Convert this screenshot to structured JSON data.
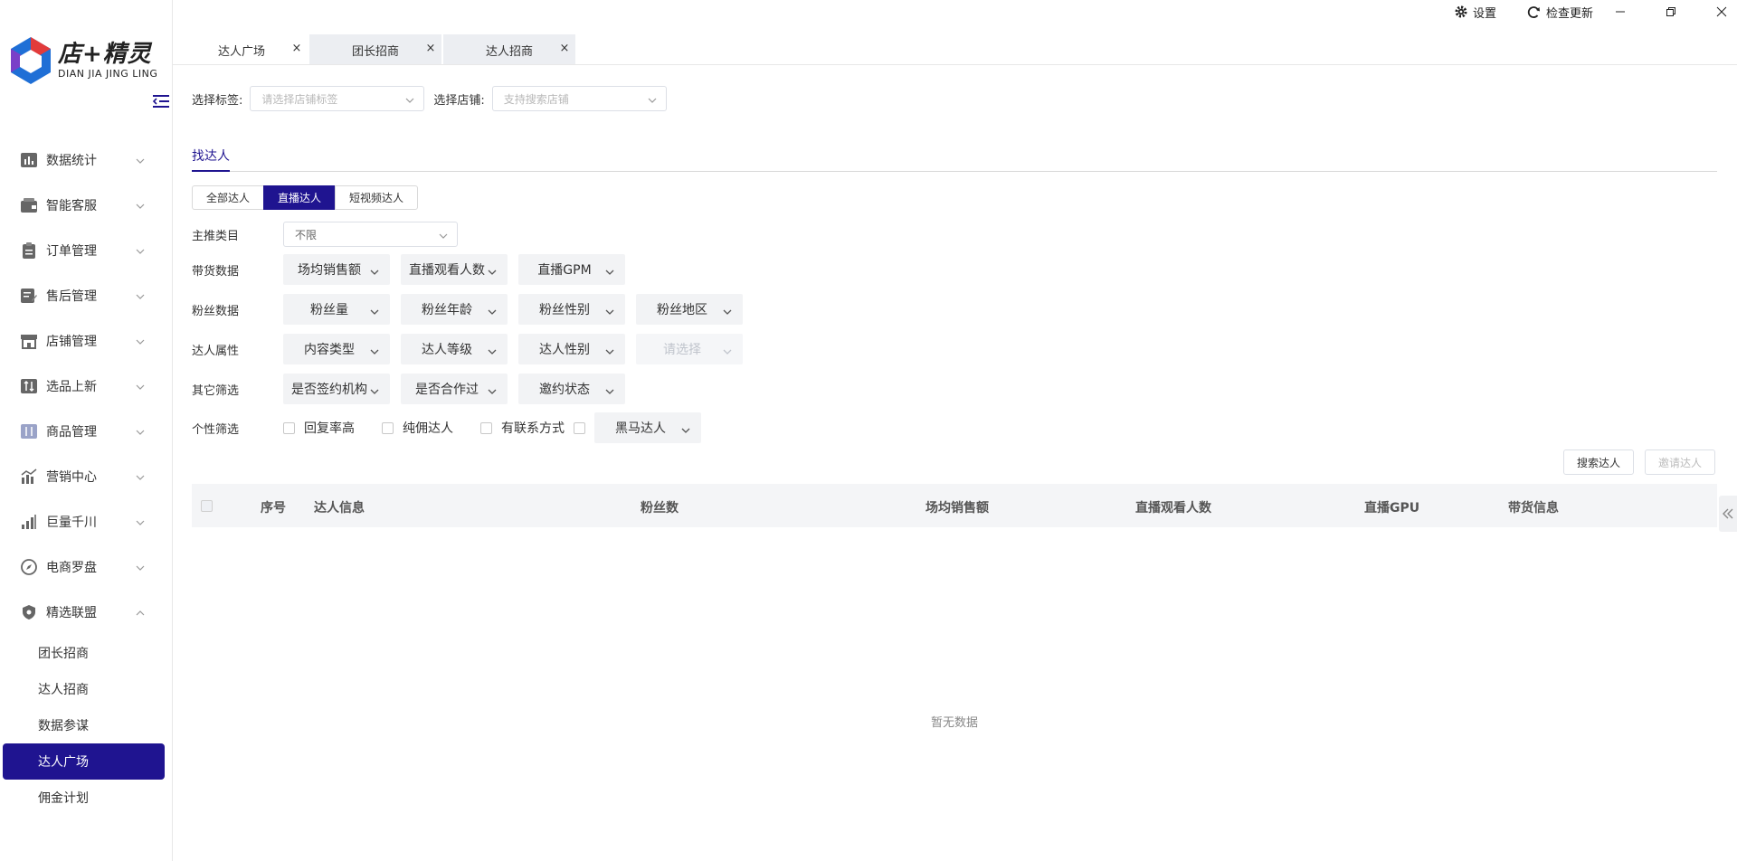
{
  "window": {
    "settings_label": "设置",
    "update_label": "检查更新"
  },
  "brand": {
    "name_cn": "店+精灵",
    "name_en": "DIAN JIA JING LING",
    "colors": {
      "primary": "#1f1490",
      "logo_blue": "#1f6fd6",
      "logo_red": "#e23b3b"
    }
  },
  "sidebar": {
    "items": [
      {
        "label": "数据统计",
        "icon": "bar-chart-icon"
      },
      {
        "label": "智能客服",
        "icon": "wallet-icon"
      },
      {
        "label": "订单管理",
        "icon": "clipboard-icon"
      },
      {
        "label": "售后管理",
        "icon": "edit-note-icon"
      },
      {
        "label": "店铺管理",
        "icon": "store-icon"
      },
      {
        "label": "选品上新",
        "icon": "swap-icon"
      },
      {
        "label": "商品管理",
        "icon": "goods-icon"
      },
      {
        "label": "营销中心",
        "icon": "trend-chart-icon"
      },
      {
        "label": "巨量千川",
        "icon": "signal-icon"
      },
      {
        "label": "电商罗盘",
        "icon": "compass-icon"
      },
      {
        "label": "精选联盟",
        "icon": "shield-icon"
      }
    ],
    "submenu": [
      {
        "label": "团长招商",
        "active": false
      },
      {
        "label": "达人招商",
        "active": false
      },
      {
        "label": "数据参谋",
        "active": false
      },
      {
        "label": "达人广场",
        "active": true
      },
      {
        "label": "佣金计划",
        "active": false
      }
    ]
  },
  "tabs": [
    {
      "label": "达人广场",
      "active": true
    },
    {
      "label": "团长招商",
      "active": false
    },
    {
      "label": "达人招商",
      "active": false
    }
  ],
  "filters_top": {
    "tag_label": "选择标签:",
    "tag_placeholder": "请选择店铺标签",
    "shop_label": "选择店铺:",
    "shop_placeholder": "支持搜索店铺"
  },
  "subtab": "找达人",
  "segments": [
    {
      "label": "全部达人",
      "active": false
    },
    {
      "label": "直播达人",
      "active": true
    },
    {
      "label": "短视频达人",
      "active": false
    }
  ],
  "main_category": {
    "label": "主推类目",
    "value": "不限"
  },
  "filter_rows": [
    {
      "label": "带货数据",
      "selects": [
        {
          "text": "场均销售额"
        },
        {
          "text": "直播观看人数"
        },
        {
          "text": "直播GPM"
        }
      ]
    },
    {
      "label": "粉丝数据",
      "selects": [
        {
          "text": "粉丝量"
        },
        {
          "text": "粉丝年龄"
        },
        {
          "text": "粉丝性别"
        },
        {
          "text": "粉丝地区"
        }
      ]
    },
    {
      "label": "达人属性",
      "selects": [
        {
          "text": "内容类型"
        },
        {
          "text": "达人等级"
        },
        {
          "text": "达人性别"
        },
        {
          "text": "请选择",
          "disabled": true
        }
      ]
    },
    {
      "label": "其它筛选",
      "selects": [
        {
          "text": "是否签约机构"
        },
        {
          "text": "是否合作过"
        },
        {
          "text": "邀约状态"
        }
      ]
    }
  ],
  "personal_filter": {
    "label": "个性筛选",
    "checkboxes": [
      "回复率高",
      "纯佣达人",
      "有联系方式"
    ],
    "select": "黑马达人"
  },
  "actions": {
    "search": "搜索达人",
    "invite": "邀请达人"
  },
  "table": {
    "columns": [
      "序号",
      "达人信息",
      "粉丝数",
      "场均销售额",
      "直播观看人数",
      "直播GPU",
      "带货信息"
    ],
    "empty_text": "暂无数据"
  }
}
